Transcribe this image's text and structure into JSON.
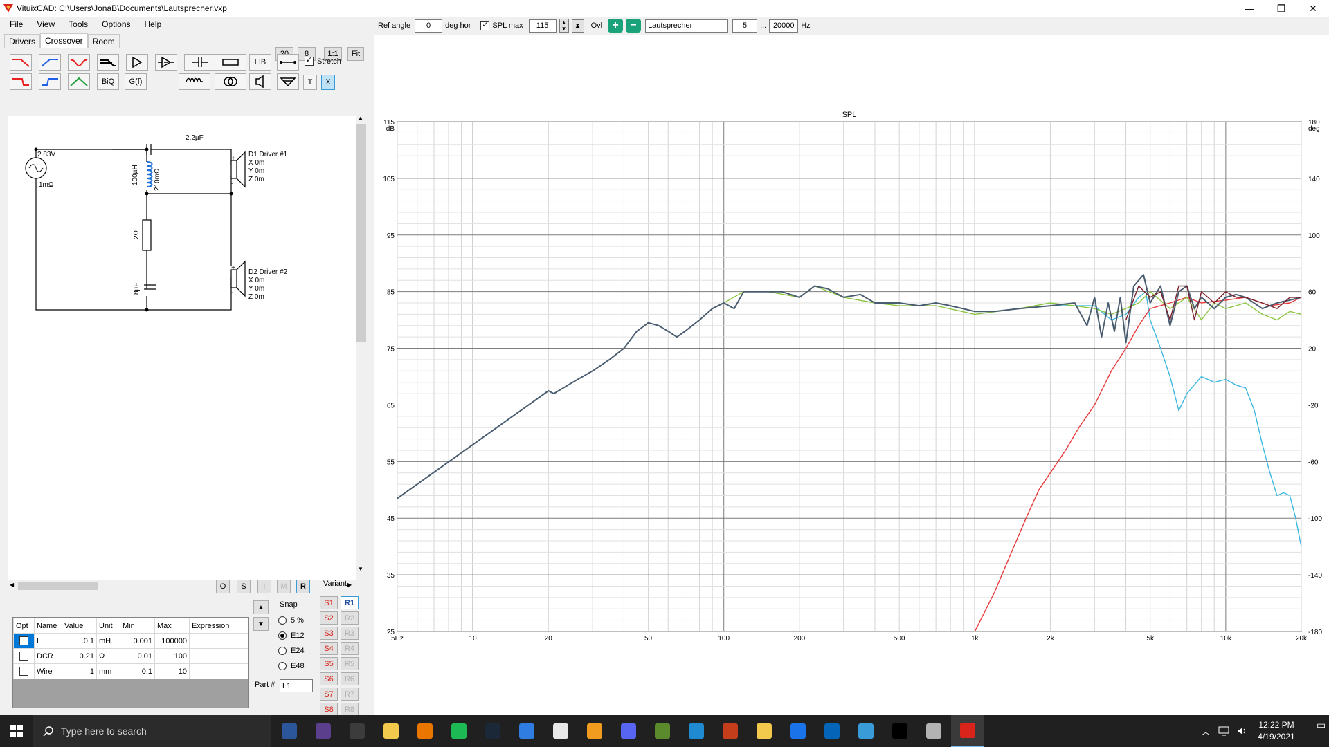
{
  "window": {
    "title": "VituixCAD: C:\\Users\\JonaB\\Documents\\Lautsprecher.vxp"
  },
  "menu": [
    "File",
    "View",
    "Tools",
    "Options",
    "Help"
  ],
  "tabs": [
    "Drivers",
    "Crossover",
    "Room"
  ],
  "zoom_buttons": [
    "20",
    "8",
    "1:1",
    "Fit"
  ],
  "toolbar": {
    "lib_label": "LIB",
    "biq_label": "BiQ",
    "gf_label": "G(f)",
    "t_label": "T",
    "x_label": "X",
    "stretch_label": "Stretch",
    "stretch_checked": true
  },
  "schematic": {
    "source_voltage": "2.83V",
    "source_resistance": "1mΩ",
    "capacitor1": "2.2µF",
    "inductor": "100µH",
    "inductor_r": "210mΩ",
    "resistor": "2Ω",
    "capacitor2": "8µF",
    "driver1": {
      "name": "D1 Driver #1",
      "x": "X 0m",
      "y": "Y 0m",
      "z": "Z 0m"
    },
    "driver2": {
      "name": "D2 Driver #2",
      "x": "X 0m",
      "y": "Y 0m",
      "z": "Z 0m"
    }
  },
  "opt_buttons": [
    "O",
    "S",
    "I",
    "M",
    "R"
  ],
  "parts": {
    "headers": [
      "Opt",
      "Name",
      "Value",
      "Unit",
      "Min",
      "Max",
      "Expression"
    ],
    "rows": [
      {
        "name": "L",
        "value": "0.1",
        "unit": "mH",
        "min": "0.001",
        "max": "100000",
        "expr": ""
      },
      {
        "name": "DCR",
        "value": "0.21",
        "unit": "Ω",
        "min": "0.01",
        "max": "100",
        "expr": ""
      },
      {
        "name": "Wire",
        "value": "1",
        "unit": "mm",
        "min": "0.1",
        "max": "10",
        "expr": ""
      }
    ]
  },
  "snap": {
    "label": "Snap",
    "options": [
      "5 %",
      "E12",
      "E24",
      "E48"
    ],
    "selected": "E12"
  },
  "part_no": {
    "label": "Part #",
    "value": "L1"
  },
  "variant": {
    "label": "Variant",
    "s": [
      "S1",
      "S2",
      "S3",
      "S4",
      "S5",
      "S6",
      "S7",
      "S8"
    ],
    "r": [
      "R1",
      "R2",
      "R3",
      "R4",
      "R5",
      "R6",
      "R7",
      "R8"
    ]
  },
  "chart_toolbar": {
    "ref_angle_label": "Ref angle",
    "ref_angle": "0",
    "deg_hor": "deg hor",
    "spl_max_label": "SPL max",
    "spl_max": "115",
    "ovl": "Ovl",
    "name": "Lautsprecher",
    "freq_from": "5",
    "dots": "...",
    "freq_to": "20000",
    "hz": "Hz"
  },
  "colors": {
    "total": "#4a5d70",
    "sum_green": "#8cc63f",
    "woofer": "#3bb7e0",
    "tweeter": "#e83a3a",
    "dark_red": "#7a1f2b",
    "teal": "#2e7c7c"
  },
  "chart_data": {
    "type": "line",
    "title": "SPL",
    "xscale": "log",
    "xlim": [
      5,
      20000
    ],
    "ylim": [
      25,
      115
    ],
    "y2lim": [
      -180,
      180
    ],
    "y_unit": "dB",
    "y2_unit": "deg",
    "x_ticks": [
      "5Hz",
      "10",
      "20",
      "50",
      "100",
      "200",
      "500",
      "1k",
      "2k",
      "5k",
      "10k",
      "20k"
    ],
    "x_tick_values": [
      5,
      10,
      20,
      50,
      100,
      200,
      500,
      1000,
      2000,
      5000,
      10000,
      20000
    ],
    "y_ticks": [
      25,
      35,
      45,
      55,
      65,
      75,
      85,
      95,
      105,
      115
    ],
    "y2_ticks": [
      -180,
      -140,
      -100,
      -60,
      -20,
      20,
      60,
      100,
      140,
      180
    ],
    "series": [
      {
        "color": "#3bb7e0",
        "points": [
          [
            5,
            48.5
          ],
          [
            10,
            58
          ],
          [
            20,
            67.5
          ],
          [
            21,
            67
          ],
          [
            25,
            69
          ],
          [
            30,
            71
          ],
          [
            35,
            73
          ],
          [
            40,
            75
          ],
          [
            45,
            78
          ],
          [
            50,
            79.5
          ],
          [
            55,
            79
          ],
          [
            60,
            78
          ],
          [
            65,
            77
          ],
          [
            70,
            78
          ],
          [
            80,
            80
          ],
          [
            90,
            82
          ],
          [
            100,
            83
          ],
          [
            110,
            82
          ],
          [
            120,
            85
          ],
          [
            150,
            85
          ],
          [
            170,
            85
          ],
          [
            200,
            84
          ],
          [
            230,
            86
          ],
          [
            260,
            85.5
          ],
          [
            300,
            84
          ],
          [
            350,
            84.5
          ],
          [
            400,
            83
          ],
          [
            500,
            83
          ],
          [
            600,
            82.5
          ],
          [
            700,
            83
          ],
          [
            800,
            82.5
          ],
          [
            1000,
            81.5
          ],
          [
            1200,
            81.5
          ],
          [
            1500,
            82
          ],
          [
            2000,
            82.5
          ],
          [
            2500,
            82.5
          ],
          [
            3000,
            82.5
          ],
          [
            3500,
            80
          ],
          [
            4000,
            81
          ],
          [
            4500,
            84
          ],
          [
            4800,
            85
          ],
          [
            5000,
            80
          ],
          [
            5500,
            75
          ],
          [
            6000,
            70
          ],
          [
            6500,
            64
          ],
          [
            7000,
            67
          ],
          [
            8000,
            70
          ],
          [
            9000,
            69
          ],
          [
            10000,
            69.5
          ],
          [
            11000,
            68.5
          ],
          [
            12000,
            68
          ],
          [
            13000,
            64
          ],
          [
            14000,
            58
          ],
          [
            15000,
            53
          ],
          [
            16000,
            49
          ],
          [
            17000,
            49.5
          ],
          [
            18000,
            49
          ],
          [
            19000,
            45
          ],
          [
            20000,
            40
          ]
        ]
      },
      {
        "color": "#e83a3a",
        "points": [
          [
            1000,
            25
          ],
          [
            1200,
            32
          ],
          [
            1400,
            39
          ],
          [
            1600,
            45
          ],
          [
            1800,
            50
          ],
          [
            2000,
            53
          ],
          [
            2300,
            57
          ],
          [
            2600,
            61
          ],
          [
            3000,
            65
          ],
          [
            3500,
            71
          ],
          [
            4000,
            75
          ],
          [
            4500,
            79
          ],
          [
            5000,
            82
          ],
          [
            6000,
            83
          ],
          [
            7000,
            84
          ],
          [
            8000,
            83
          ],
          [
            10000,
            83.5
          ],
          [
            12000,
            84
          ],
          [
            15000,
            82.5
          ],
          [
            18000,
            83
          ],
          [
            20000,
            84
          ]
        ]
      },
      {
        "color": "#8cc63f",
        "points": [
          [
            100,
            83
          ],
          [
            120,
            85
          ],
          [
            150,
            85
          ],
          [
            200,
            84
          ],
          [
            230,
            86
          ],
          [
            300,
            84
          ],
          [
            400,
            83
          ],
          [
            500,
            82.5
          ],
          [
            700,
            82.5
          ],
          [
            1000,
            81
          ],
          [
            1500,
            82
          ],
          [
            2000,
            83
          ],
          [
            2500,
            82.5
          ],
          [
            3000,
            82
          ],
          [
            3500,
            81
          ],
          [
            4000,
            82
          ],
          [
            4500,
            83
          ],
          [
            5000,
            85
          ],
          [
            6000,
            82
          ],
          [
            7000,
            84
          ],
          [
            8000,
            80
          ],
          [
            9000,
            83
          ],
          [
            10000,
            82
          ],
          [
            12000,
            83
          ],
          [
            14000,
            81
          ],
          [
            16000,
            80
          ],
          [
            18000,
            81.5
          ],
          [
            20000,
            81
          ]
        ]
      },
      {
        "color": "#4a5d70",
        "points": [
          [
            5,
            48.5
          ],
          [
            10,
            58
          ],
          [
            20,
            67.5
          ],
          [
            21,
            67
          ],
          [
            25,
            69
          ],
          [
            30,
            71
          ],
          [
            35,
            73
          ],
          [
            40,
            75
          ],
          [
            45,
            78
          ],
          [
            50,
            79.5
          ],
          [
            55,
            79
          ],
          [
            60,
            78
          ],
          [
            65,
            77
          ],
          [
            70,
            78
          ],
          [
            80,
            80
          ],
          [
            90,
            82
          ],
          [
            100,
            83
          ],
          [
            110,
            82
          ],
          [
            120,
            85
          ],
          [
            150,
            85
          ],
          [
            170,
            85
          ],
          [
            200,
            84
          ],
          [
            230,
            86
          ],
          [
            260,
            85.5
          ],
          [
            300,
            84
          ],
          [
            350,
            84.5
          ],
          [
            400,
            83
          ],
          [
            500,
            83
          ],
          [
            600,
            82.5
          ],
          [
            700,
            83
          ],
          [
            800,
            82.5
          ],
          [
            1000,
            81.5
          ],
          [
            1200,
            81.5
          ],
          [
            1500,
            82
          ],
          [
            2000,
            82.5
          ],
          [
            2500,
            83
          ],
          [
            2800,
            79
          ],
          [
            3000,
            84
          ],
          [
            3200,
            77
          ],
          [
            3400,
            83
          ],
          [
            3600,
            78
          ],
          [
            3800,
            84
          ],
          [
            4000,
            76
          ],
          [
            4300,
            86
          ],
          [
            4700,
            88
          ],
          [
            5000,
            83
          ],
          [
            5500,
            86
          ],
          [
            6000,
            79
          ],
          [
            6500,
            85
          ],
          [
            7000,
            86
          ],
          [
            7500,
            82
          ],
          [
            8000,
            84
          ],
          [
            9000,
            82
          ],
          [
            10000,
            84
          ],
          [
            11000,
            84.5
          ],
          [
            12000,
            84
          ],
          [
            14000,
            82
          ],
          [
            16000,
            83
          ],
          [
            18000,
            83.5
          ],
          [
            20000,
            84
          ]
        ]
      },
      {
        "color": "#7a1f2b",
        "points": [
          [
            4000,
            80
          ],
          [
            4500,
            86
          ],
          [
            5000,
            84
          ],
          [
            5500,
            85
          ],
          [
            6000,
            80
          ],
          [
            6500,
            86
          ],
          [
            7000,
            86
          ],
          [
            7500,
            80
          ],
          [
            8000,
            85
          ],
          [
            9000,
            83
          ],
          [
            10000,
            85
          ],
          [
            11000,
            84
          ],
          [
            12000,
            84
          ],
          [
            14000,
            83
          ],
          [
            16000,
            82
          ],
          [
            18000,
            84
          ],
          [
            20000,
            84
          ]
        ]
      }
    ]
  },
  "taskbar": {
    "search_placeholder": "Type here to search",
    "time": "12:22 PM",
    "date": "4/19/2021"
  }
}
